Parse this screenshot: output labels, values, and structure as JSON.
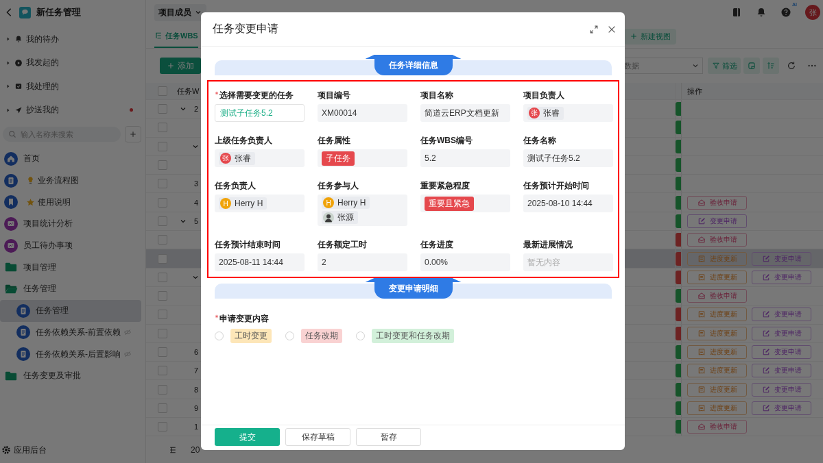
{
  "sidebar": {
    "title": "新任务管理",
    "quick": [
      {
        "label": "我的待办",
        "dot": false
      },
      {
        "label": "我发起的",
        "dot": false
      },
      {
        "label": "我处理的",
        "dot": false
      },
      {
        "label": "抄送我的",
        "dot": true
      }
    ],
    "search": {
      "placeholder": "输入名称来搜索"
    },
    "menu": [
      {
        "label": "首页",
        "selected": false,
        "hidden": false
      },
      {
        "label": "业务流程图",
        "selected": false,
        "hidden": false
      },
      {
        "label": "使用说明",
        "selected": false,
        "hidden": false
      },
      {
        "label": "项目统计分析",
        "selected": false,
        "hidden": false
      },
      {
        "label": "员工待办事项",
        "selected": false,
        "hidden": false
      },
      {
        "label": "项目管理",
        "selected": false,
        "hidden": false
      },
      {
        "label": "任务管理",
        "selected": false,
        "hidden": false,
        "expanded": true,
        "children": [
          {
            "label": "任务管理",
            "selected": true,
            "hidden": false
          },
          {
            "label": "任务依赖关系-前置依赖",
            "selected": false,
            "hidden": true
          },
          {
            "label": "任务依赖关系-后置影响",
            "selected": false,
            "hidden": true
          }
        ]
      },
      {
        "label": "任务变更及审批",
        "selected": false,
        "hidden": false
      }
    ],
    "footer": "应用后台"
  },
  "topbar": {
    "member_dropdown": "项目成员",
    "help_badge": "AI",
    "avatar": "张"
  },
  "views": {
    "tabs": [
      {
        "label": "任务WBS",
        "selected": true
      }
    ],
    "new_view": "新建视图"
  },
  "toolbar": {
    "add": "添加",
    "search_placeholder": "数据",
    "filter": "筛选"
  },
  "table": {
    "columns": [
      "任务W",
      "操作"
    ],
    "page_size": "20",
    "all_checked": false,
    "rows": [
      {
        "wbs": "2",
        "overdue": false,
        "selected": false,
        "expanded": true,
        "children": [
          {
            "overdue": false,
            "selected": false
          },
          {
            "overdue": false,
            "selected": false,
            "expanded": true,
            "children": [
              {
                "overdue": false,
                "selected": false
              }
            ]
          }
        ]
      },
      {
        "wbs": "3",
        "overdue": false,
        "selected": false
      },
      {
        "wbs": "4",
        "overdue": false,
        "selected": false,
        "actions": [
          {
            "kind": "accept",
            "label": "验收申请"
          }
        ]
      },
      {
        "wbs": "5",
        "overdue": false,
        "selected": false,
        "actions": [
          {
            "kind": "change",
            "label": "变更申请"
          }
        ],
        "expanded": true,
        "children": [
          {
            "overdue": true,
            "selected": false,
            "actions": [
              {
                "kind": "accept",
                "label": "验收申请"
              }
            ]
          },
          {
            "overdue": true,
            "selected": true,
            "actions": [
              {
                "kind": "progress",
                "label": "进度更新"
              },
              {
                "kind": "change",
                "label": "变更申请"
              }
            ]
          },
          {
            "overdue": true,
            "selected": false,
            "actions": [
              {
                "kind": "progress",
                "label": "进度更新"
              },
              {
                "kind": "change",
                "label": "变更申请"
              }
            ],
            "expanded": true,
            "children": [
              {
                "overdue": false,
                "selected": false,
                "actions": [
                  {
                    "kind": "accept",
                    "label": "验收申请"
                  }
                ]
              },
              {
                "overdue": true,
                "selected": false,
                "actions": [
                  {
                    "kind": "progress",
                    "label": "进度更新"
                  },
                  {
                    "kind": "change",
                    "label": "变更申请"
                  }
                ]
              },
              {
                "overdue": true,
                "selected": false,
                "actions": [
                  {
                    "kind": "progress",
                    "label": "进度更新"
                  },
                  {
                    "kind": "change",
                    "label": "变更申请"
                  }
                ]
              }
            ]
          }
        ]
      },
      {
        "wbs": "6",
        "overdue": false,
        "selected": false,
        "actions": [
          {
            "kind": "progress",
            "label": "进度更新"
          },
          {
            "kind": "change",
            "label": "变更申请"
          }
        ]
      },
      {
        "wbs": "7",
        "overdue": false,
        "selected": false,
        "actions": [
          {
            "kind": "progress",
            "label": "进度更新"
          },
          {
            "kind": "change",
            "label": "变更申请"
          }
        ]
      },
      {
        "wbs": "8",
        "overdue": false,
        "selected": false,
        "actions": [
          {
            "kind": "progress",
            "label": "进度更新"
          },
          {
            "kind": "change",
            "label": "变更申请"
          }
        ]
      },
      {
        "wbs": "9",
        "overdue": false,
        "selected": false,
        "actions": [
          {
            "kind": "progress",
            "label": "进度更新"
          },
          {
            "kind": "change",
            "label": "变更申请"
          }
        ]
      },
      {
        "wbs": "1",
        "overdue": false,
        "selected": false,
        "actions": [
          {
            "kind": "accept",
            "label": "验收申请"
          }
        ]
      }
    ]
  },
  "modal": {
    "title": "任务变更申请",
    "sections": [
      {
        "title": "任务详细信息",
        "highlighted": true,
        "fields": [
          {
            "label": "选择需要变更的任务",
            "required": true,
            "kind": "select",
            "value": "测试子任务5.2"
          },
          {
            "label": "项目编号",
            "kind": "text",
            "value": "XM00014"
          },
          {
            "label": "项目名称",
            "kind": "text",
            "value": "简道云ERP文档更新"
          },
          {
            "label": "项目负责人",
            "kind": "person",
            "people": [
              {
                "name": "张睿",
                "avatar": "张",
                "color": "#e5484d"
              }
            ]
          },
          {
            "label": "上级任务负责人",
            "kind": "person",
            "people": [
              {
                "name": "张睿",
                "avatar": "张",
                "color": "#e5484d"
              }
            ]
          },
          {
            "label": "任务属性",
            "kind": "tag",
            "value": "子任务",
            "color": "#e5484d"
          },
          {
            "label": "任务WBS编号",
            "kind": "text",
            "value": "5.2"
          },
          {
            "label": "任务名称",
            "kind": "text",
            "value": "测试子任务5.2"
          },
          {
            "label": "任务负责人",
            "kind": "person",
            "people": [
              {
                "name": "Herry H",
                "avatar": "H",
                "color": "#f0a30a"
              }
            ]
          },
          {
            "label": "任务参与人",
            "kind": "person",
            "people": [
              {
                "name": "Herry H",
                "avatar": "H",
                "color": "#f0a30a"
              },
              {
                "name": "张源"
              }
            ]
          },
          {
            "label": "重要紧急程度",
            "kind": "tag",
            "value": "重要且紧急",
            "color": "#e5484d"
          },
          {
            "label": "任务预计开始时间",
            "kind": "text",
            "value": "2025-08-10 14:44"
          },
          {
            "label": "任务预计结束时间",
            "kind": "text",
            "value": "2025-08-11 14:44"
          },
          {
            "label": "任务额定工时",
            "kind": "text",
            "value": "2"
          },
          {
            "label": "任务进度",
            "kind": "text",
            "value": "0.00%"
          },
          {
            "label": "最新进展情况",
            "kind": "text",
            "placeholder": "暂无内容"
          }
        ]
      },
      {
        "title": "变更申请明细",
        "highlighted": false,
        "fields": [
          {
            "label": "申请变更内容",
            "required": true,
            "kind": "radio",
            "options": [
              {
                "label": "工时变更",
                "color": "#fde6b8",
                "selected": false
              },
              {
                "label": "任务改期",
                "color": "#f9d2d2",
                "selected": false
              },
              {
                "label": "工时变更和任务改期",
                "color": "#d2f0da",
                "selected": false
              }
            ]
          }
        ]
      }
    ],
    "buttons": [
      {
        "label": "提交",
        "kind": "primary"
      },
      {
        "label": "保存草稿",
        "kind": "default"
      },
      {
        "label": "暂存",
        "kind": "default"
      }
    ]
  }
}
